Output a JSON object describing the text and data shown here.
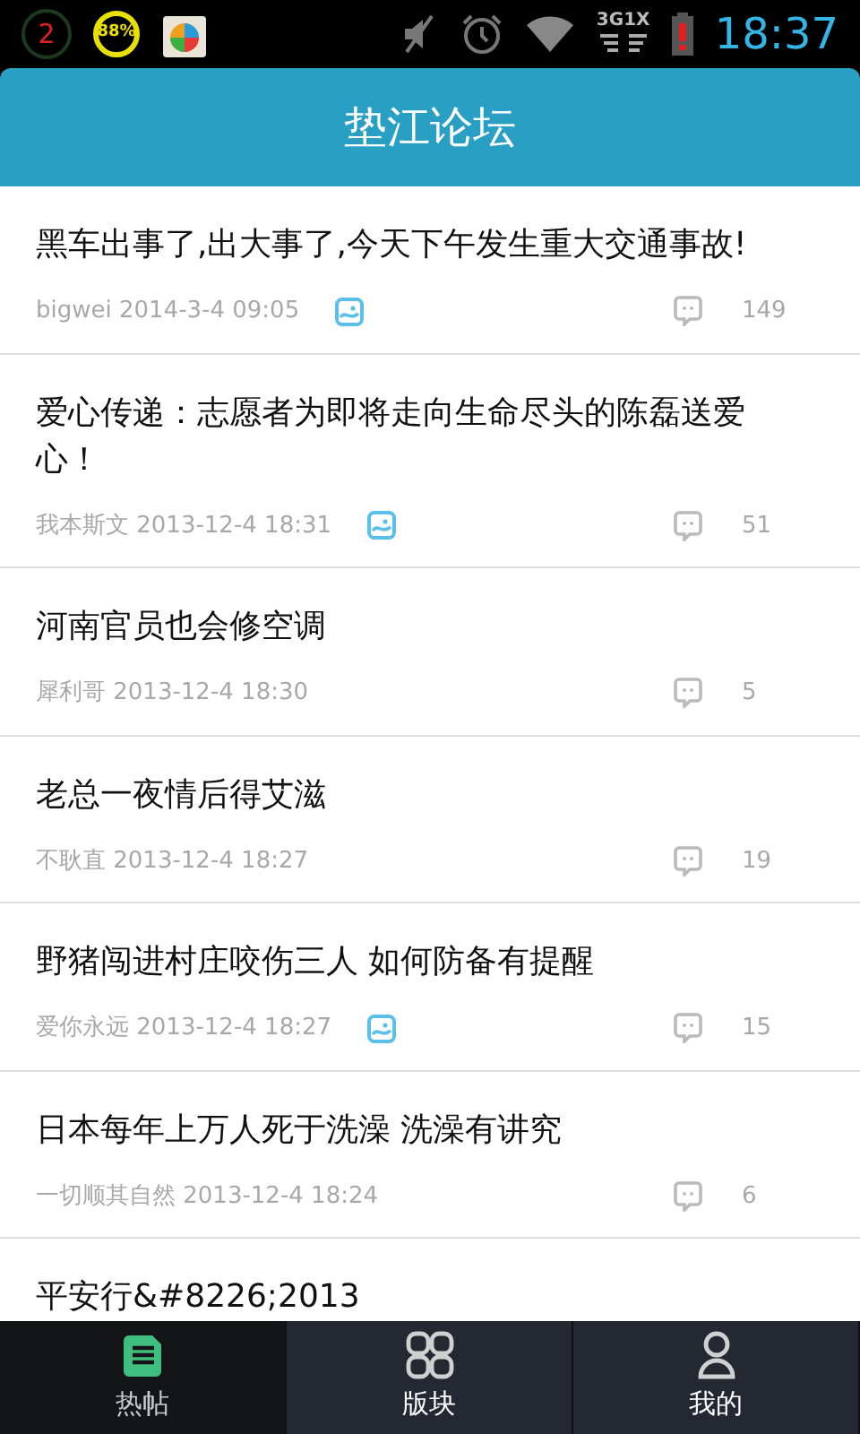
{
  "status_bar": {
    "notification_count": "2",
    "battery_percent": "88%",
    "network": "3G1X",
    "time": "18:37"
  },
  "header": {
    "title": "垫江论坛"
  },
  "posts": [
    {
      "title": "黑车出事了,出大事了,今天下午发生重大交通事故!",
      "author": "bigwei",
      "time": "2014-3-4 09:05",
      "has_image": true,
      "replies": "149"
    },
    {
      "title": "爱心传递：志愿者为即将走向生命尽头的陈磊送爱心！",
      "author": "我本斯文",
      "time": "2013-12-4 18:31",
      "has_image": true,
      "replies": "51"
    },
    {
      "title": "河南官员也会修空调",
      "author": "犀利哥",
      "time": "2013-12-4 18:30",
      "has_image": false,
      "replies": "5"
    },
    {
      "title": "老总一夜情后得艾滋",
      "author": "不耿直",
      "time": "2013-12-4 18:27",
      "has_image": false,
      "replies": "19"
    },
    {
      "title": "野猪闯进村庄咬伤三人 如何防备有提醒",
      "author": "爱你永远",
      "time": "2013-12-4 18:27",
      "has_image": true,
      "replies": "15"
    },
    {
      "title": "日本每年上万人死于洗澡 洗澡有讲究",
      "author": "一切顺其自然",
      "time": "2013-12-4 18:24",
      "has_image": false,
      "replies": "6"
    },
    {
      "title": "平安行&#8226;2013"
    }
  ],
  "tabs": [
    {
      "kind": "posts",
      "label": "热帖",
      "selected": true
    },
    {
      "kind": "boards",
      "label": "版块",
      "selected": false
    },
    {
      "kind": "me",
      "label": "我的",
      "selected": false
    }
  ]
}
